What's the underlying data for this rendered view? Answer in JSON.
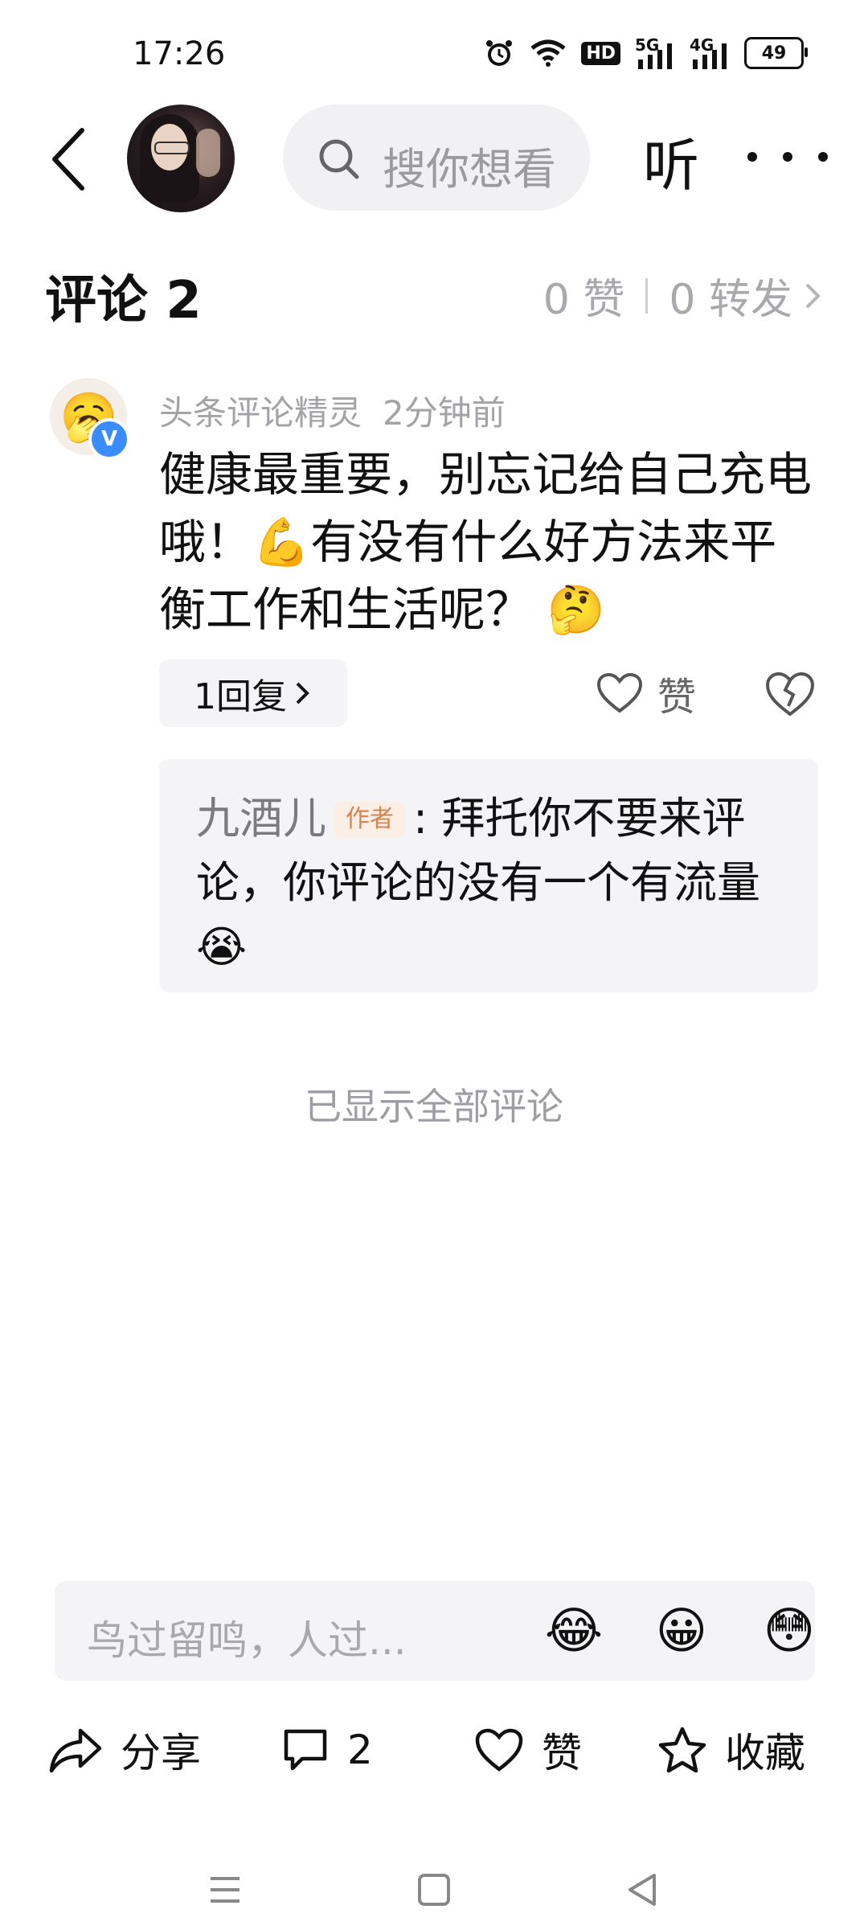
{
  "status_bar": {
    "time": "17:26",
    "hd_label": "HD",
    "net1": "5G",
    "net2": "4G",
    "battery": "49"
  },
  "header": {
    "search_placeholder": "搜你想看",
    "listen_label": "听"
  },
  "comments": {
    "title": "评论 2",
    "likes": "0 赞",
    "forwards": "0 转发",
    "item": {
      "author": "头条评论精灵",
      "time": "2分钟前",
      "avatar_emoji": "🥱",
      "verified_badge": "V",
      "body_part1": "健康最重要，别忘记给自己充电哦！",
      "body_emoji1": "💪",
      "body_part2": "有没有什么好方法来平衡工作和生活呢？",
      "body_emoji2": "🤔",
      "reply_button": "1回复",
      "like_label": "赞",
      "reply": {
        "author": "九酒儿",
        "tag": "作者",
        "text": ": 拜托你不要来评论，你评论的没有一个有流量",
        "emoji": "😭"
      }
    },
    "all_shown": "已显示全部评论"
  },
  "input_bar": {
    "placeholder": "鸟过留鸣，人过...",
    "emojis": [
      "😂",
      "😀",
      "😳"
    ]
  },
  "actions": {
    "share": "分享",
    "comment_count": "2",
    "like": "赞",
    "favorite": "收藏"
  },
  "icons": {
    "status": [
      "alarm-icon",
      "wifi-icon",
      "hd-icon",
      "signal-5g-icon",
      "signal-4g-icon",
      "battery-icon"
    ],
    "header": [
      "back-icon",
      "search-icon",
      "more-icon"
    ],
    "comment": [
      "heart-icon",
      "broken-heart-icon"
    ],
    "actions": [
      "share-icon",
      "comment-icon",
      "heart-icon",
      "star-icon"
    ],
    "nav": [
      "menu-icon",
      "home-icon",
      "back-triangle-icon"
    ]
  },
  "colors": {
    "muted_text": "#a3a3a8",
    "panel_bg": "#f4f4f6",
    "author_tag_bg": "#fbeee4",
    "author_tag_text": "#d6844f",
    "verified_blue": "#3b8cff"
  }
}
